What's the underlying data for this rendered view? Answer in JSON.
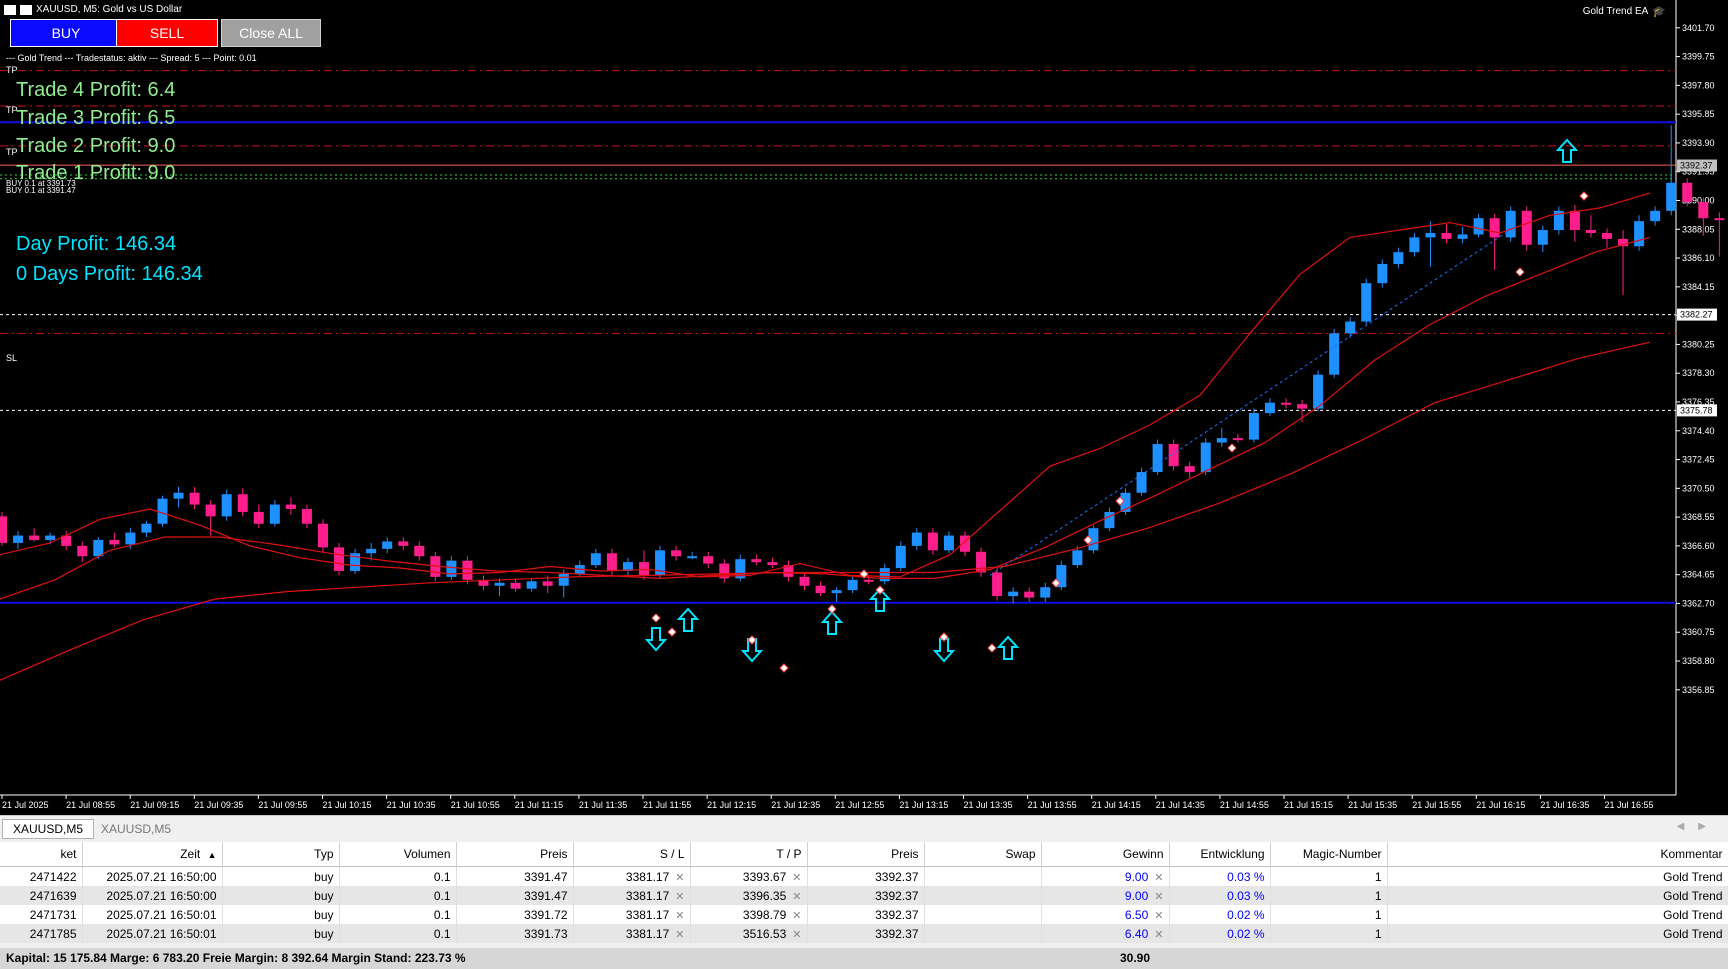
{
  "window": {
    "title": "XAUUSD, M5:  Gold vs US Dollar",
    "ea_name": "Gold Trend EA"
  },
  "buttons": {
    "buy": "BUY",
    "sell": "SELL",
    "close_all": "Close ALL"
  },
  "info_line": "--- Gold Trend --- Tradestatus: aktiv --- Spread: 5 --- Point: 0.01",
  "profits": {
    "trade4": "Trade 4 Profit: 6.4",
    "trade3": "Trade 3 Profit: 6.5",
    "trade2": "Trade 2 Profit: 9.0",
    "trade1": "Trade 1 Profit: 9.0",
    "day": "Day Profit: 146.34",
    "days": "0 Days Profit: 146.34"
  },
  "chart": {
    "line_labels": {
      "tp": "TP",
      "sl": "SL",
      "buy_a": "BUY 0.1 at 3391.73",
      "buy_b": "BUY 0.1 at 3391.47"
    },
    "price_axis": [
      "3401.70",
      "3399.75",
      "3397.80",
      "3395.85",
      "3393.90",
      "3391.95",
      "3390.00",
      "3388.05",
      "3386.10",
      "3384.15",
      "3382.20",
      "3380.25",
      "3378.30",
      "3376.35",
      "3374.40",
      "3372.45",
      "3370.50",
      "3368.55",
      "3366.60",
      "3364.65",
      "3362.70",
      "3360.75",
      "3358.80",
      "3356.85"
    ],
    "price_tags": {
      "current": "3392.37",
      "mid": "3382.27",
      "low": "3375.78"
    },
    "time_axis": [
      "21 Jul 2025",
      "21 Jul 08:55",
      "21 Jul 09:15",
      "21 Jul 09:35",
      "21 Jul 09:55",
      "21 Jul 10:15",
      "21 Jul 10:35",
      "21 Jul 10:55",
      "21 Jul 11:15",
      "21 Jul 11:35",
      "21 Jul 11:55",
      "21 Jul 12:15",
      "21 Jul 12:35",
      "21 Jul 12:55",
      "21 Jul 13:15",
      "21 Jul 13:35",
      "21 Jul 13:55",
      "21 Jul 14:15",
      "21 Jul 14:35",
      "21 Jul 14:55",
      "21 Jul 15:15",
      "21 Jul 15:35",
      "21 Jul 15:55",
      "21 Jul 16:15",
      "21 Jul 16:35",
      "21 Jul 16:55"
    ],
    "colors": {
      "bull": "#1e90ff",
      "bear": "#ff1e8c",
      "ma": "#e01010",
      "tp_line": "#d01010",
      "blue_line": "#1010e0",
      "arrow": "#00e5ff"
    }
  },
  "chart_data": {
    "type": "candlestick",
    "symbol": "XAUUSD",
    "timeframe": "M5",
    "ylim": [
      3356.0,
      3402.5
    ],
    "ohlc": [
      [
        3368.6,
        3368.9,
        3366.6,
        3366.8
      ],
      [
        3366.8,
        3367.6,
        3366.4,
        3367.3
      ],
      [
        3367.3,
        3367.8,
        3366.9,
        3367.0
      ],
      [
        3367.0,
        3367.5,
        3366.7,
        3367.3
      ],
      [
        3367.3,
        3367.6,
        3366.3,
        3366.6
      ],
      [
        3366.6,
        3366.9,
        3365.5,
        3365.9
      ],
      [
        3365.9,
        3367.2,
        3365.7,
        3367.0
      ],
      [
        3367.0,
        3367.5,
        3366.5,
        3366.7
      ],
      [
        3366.7,
        3367.8,
        3366.4,
        3367.5
      ],
      [
        3367.5,
        3368.3,
        3367.2,
        3368.1
      ],
      [
        3368.1,
        3370.0,
        3367.9,
        3369.8
      ],
      [
        3369.8,
        3370.6,
        3369.2,
        3370.2
      ],
      [
        3370.2,
        3370.6,
        3369.1,
        3369.4
      ],
      [
        3369.4,
        3369.7,
        3367.3,
        3368.6
      ],
      [
        3368.6,
        3370.4,
        3368.3,
        3370.1
      ],
      [
        3370.1,
        3370.5,
        3368.6,
        3368.9
      ],
      [
        3368.9,
        3369.4,
        3367.8,
        3368.1
      ],
      [
        3368.1,
        3369.7,
        3367.9,
        3369.4
      ],
      [
        3369.4,
        3369.9,
        3368.7,
        3369.1
      ],
      [
        3369.1,
        3369.4,
        3367.8,
        3368.1
      ],
      [
        3368.1,
        3368.4,
        3366.2,
        3366.5
      ],
      [
        3366.5,
        3366.8,
        3364.6,
        3364.9
      ],
      [
        3364.9,
        3366.4,
        3364.7,
        3366.1
      ],
      [
        3366.1,
        3366.8,
        3365.6,
        3366.4
      ],
      [
        3366.4,
        3367.2,
        3366.1,
        3366.9
      ],
      [
        3366.9,
        3367.2,
        3366.3,
        3366.6
      ],
      [
        3366.6,
        3366.9,
        3365.6,
        3365.9
      ],
      [
        3365.9,
        3366.2,
        3364.2,
        3364.5
      ],
      [
        3364.5,
        3365.9,
        3364.3,
        3365.6
      ],
      [
        3365.6,
        3365.9,
        3364.0,
        3364.3
      ],
      [
        3364.3,
        3364.6,
        3363.6,
        3363.9
      ],
      [
        3363.9,
        3364.4,
        3363.2,
        3364.1
      ],
      [
        3364.1,
        3364.4,
        3363.5,
        3363.7
      ],
      [
        3363.7,
        3364.4,
        3363.5,
        3364.2
      ],
      [
        3364.2,
        3364.6,
        3363.4,
        3363.9
      ],
      [
        3363.9,
        3365.0,
        3363.1,
        3364.7
      ],
      [
        3364.7,
        3365.6,
        3364.5,
        3365.3
      ],
      [
        3365.3,
        3366.4,
        3365.1,
        3366.1
      ],
      [
        3366.1,
        3366.4,
        3364.6,
        3364.9
      ],
      [
        3364.9,
        3365.8,
        3364.6,
        3365.5
      ],
      [
        3365.5,
        3366.3,
        3364.3,
        3364.6
      ],
      [
        3364.6,
        3366.6,
        3364.4,
        3366.3
      ],
      [
        3366.3,
        3366.6,
        3365.6,
        3365.9
      ],
      [
        3365.9,
        3366.2,
        3365.7,
        3365.9
      ],
      [
        3365.9,
        3366.2,
        3365.1,
        3365.4
      ],
      [
        3365.4,
        3365.7,
        3364.1,
        3364.4
      ],
      [
        3364.4,
        3366.0,
        3364.2,
        3365.7
      ],
      [
        3365.7,
        3366.0,
        3365.3,
        3365.5
      ],
      [
        3365.5,
        3365.8,
        3365.1,
        3365.3
      ],
      [
        3365.3,
        3365.6,
        3364.2,
        3364.5
      ],
      [
        3364.5,
        3364.8,
        3363.6,
        3363.9
      ],
      [
        3363.9,
        3364.2,
        3363.2,
        3363.4
      ],
      [
        3363.4,
        3363.8,
        3362.8,
        3363.6
      ],
      [
        3363.6,
        3364.5,
        3363.4,
        3364.3
      ],
      [
        3364.3,
        3364.6,
        3364.0,
        3364.2
      ],
      [
        3364.2,
        3365.4,
        3364.0,
        3365.1
      ],
      [
        3365.1,
        3366.9,
        3364.9,
        3366.6
      ],
      [
        3366.6,
        3367.8,
        3366.3,
        3367.5
      ],
      [
        3367.5,
        3367.8,
        3366.0,
        3366.3
      ],
      [
        3366.3,
        3367.6,
        3366.1,
        3367.3
      ],
      [
        3367.3,
        3367.6,
        3365.9,
        3366.2
      ],
      [
        3366.2,
        3366.5,
        3364.5,
        3364.8
      ],
      [
        3364.8,
        3365.1,
        3362.9,
        3363.2
      ],
      [
        3363.2,
        3363.8,
        3362.7,
        3363.5
      ],
      [
        3363.5,
        3363.8,
        3362.8,
        3363.1
      ],
      [
        3363.1,
        3364.1,
        3362.8,
        3363.8
      ],
      [
        3363.8,
        3365.6,
        3363.6,
        3365.3
      ],
      [
        3365.3,
        3366.6,
        3365.1,
        3366.3
      ],
      [
        3366.3,
        3368.0,
        3366.1,
        3367.8
      ],
      [
        3367.8,
        3369.2,
        3367.6,
        3368.9
      ],
      [
        3368.9,
        3370.5,
        3368.7,
        3370.2
      ],
      [
        3370.2,
        3371.9,
        3370.0,
        3371.6
      ],
      [
        3371.6,
        3373.8,
        3371.4,
        3373.5
      ],
      [
        3373.5,
        3373.8,
        3371.7,
        3372.0
      ],
      [
        3372.0,
        3372.3,
        3371.2,
        3371.6
      ],
      [
        3371.6,
        3373.9,
        3371.4,
        3373.6
      ],
      [
        3373.6,
        3374.6,
        3373.3,
        3373.9
      ],
      [
        3373.9,
        3374.2,
        3373.6,
        3373.8
      ],
      [
        3373.8,
        3375.9,
        3373.6,
        3375.6
      ],
      [
        3375.6,
        3376.6,
        3375.4,
        3376.3
      ],
      [
        3376.3,
        3376.6,
        3375.9,
        3376.2
      ],
      [
        3376.2,
        3376.5,
        3375.0,
        3375.9
      ],
      [
        3375.9,
        3378.5,
        3375.7,
        3378.2
      ],
      [
        3378.2,
        3381.3,
        3378.0,
        3381.0
      ],
      [
        3381.0,
        3382.1,
        3380.7,
        3381.8
      ],
      [
        3381.8,
        3384.7,
        3381.6,
        3384.4
      ],
      [
        3384.4,
        3386.0,
        3384.1,
        3385.7
      ],
      [
        3385.7,
        3386.8,
        3385.4,
        3386.5
      ],
      [
        3386.5,
        3387.8,
        3386.2,
        3387.5
      ],
      [
        3387.5,
        3388.6,
        3385.5,
        3387.8
      ],
      [
        3387.8,
        3388.4,
        3387.1,
        3387.4
      ],
      [
        3387.4,
        3388.2,
        3387.1,
        3387.7
      ],
      [
        3387.7,
        3389.1,
        3387.5,
        3388.8
      ],
      [
        3388.8,
        3389.1,
        3385.3,
        3387.5
      ],
      [
        3387.5,
        3389.6,
        3387.2,
        3389.3
      ],
      [
        3389.3,
        3389.6,
        3386.6,
        3387.0
      ],
      [
        3387.0,
        3388.3,
        3386.5,
        3388.0
      ],
      [
        3388.0,
        3389.6,
        3387.7,
        3389.3
      ],
      [
        3389.3,
        3389.7,
        3387.2,
        3388.0
      ],
      [
        3388.0,
        3389.0,
        3387.5,
        3387.8
      ],
      [
        3387.8,
        3388.1,
        3386.8,
        3387.4
      ],
      [
        3387.4,
        3388.0,
        3383.6,
        3386.9
      ],
      [
        3386.9,
        3389.0,
        3386.6,
        3388.6
      ],
      [
        3388.6,
        3389.6,
        3388.3,
        3389.3
      ],
      [
        3389.3,
        3395.1,
        3389.0,
        3391.2
      ],
      [
        3391.2,
        3391.5,
        3389.6,
        3389.9
      ],
      [
        3389.9,
        3390.2,
        3387.6,
        3388.8
      ],
      [
        3388.8,
        3389.2,
        3386.2,
        3388.7
      ],
      [
        3388.7,
        3391.6,
        3388.4,
        3391.3
      ],
      [
        3391.3,
        3392.9,
        3391.0,
        3392.37
      ]
    ],
    "moving_averages": [
      {
        "period": "fast",
        "values": [
          3366.0,
          3366.8,
          3368.4,
          3369.1,
          3368.0,
          3366.6,
          3365.8,
          3365.3,
          3365.1,
          3364.7,
          3364.8,
          3365.2,
          3364.9,
          3365.0,
          3364.5,
          3364.6,
          3365.4,
          3364.6,
          3364.5,
          3366.0,
          3369.0,
          3372.0,
          3373.2,
          3374.8,
          3376.8,
          3381.0,
          3385.0,
          3387.5,
          3388.0,
          3388.5,
          3387.8,
          3389.0,
          3389.5,
          3390.5
        ]
      },
      {
        "period": "mid",
        "values": [
          3363.0,
          3364.3,
          3366.3,
          3367.2,
          3367.2,
          3366.7,
          3366.1,
          3365.6,
          3365.2,
          3364.9,
          3364.8,
          3364.6,
          3364.4,
          3364.6,
          3364.8,
          3364.7,
          3364.4,
          3364.4,
          3365.0,
          3366.5,
          3368.3,
          3370.0,
          3371.8,
          3373.6,
          3376.1,
          3379.2,
          3381.6,
          3383.5,
          3385.0,
          3386.5,
          3387.5
        ]
      },
      {
        "period": "slow",
        "values": [
          3357.5,
          3359.6,
          3361.6,
          3363.0,
          3363.5,
          3363.8,
          3364.1,
          3364.3,
          3364.5,
          3364.6,
          3364.7,
          3364.8,
          3364.8,
          3364.8,
          3365.2,
          3366.4,
          3367.8,
          3369.5,
          3371.5,
          3373.8,
          3376.3,
          3377.8,
          3379.3,
          3380.4
        ]
      }
    ],
    "levels": {
      "tp_4": 3398.8,
      "tp_3": 3396.4,
      "blue_upper": 3395.3,
      "tp_2": 3393.7,
      "tp_1": 3392.4,
      "sl_white": 3382.27,
      "sl_red": 3381.0,
      "white_low": 3375.78,
      "blue_lower": 3362.75,
      "entry_high": 3391.73,
      "entry_low": 3391.47
    }
  },
  "tabs": [
    "XAUUSD,M5",
    "XAUUSD,M5"
  ],
  "table": {
    "headers": {
      "ticket": "ket",
      "time": "Zeit",
      "sort_indicator": "▲",
      "type": "Typ",
      "volume": "Volumen",
      "price": "Preis",
      "sl": "S / L",
      "tp": "T / P",
      "cur_price": "Preis",
      "swap": "Swap",
      "profit": "Gewinn",
      "change": "Entwicklung",
      "magic": "Magic-Number",
      "comment": "Kommentar"
    },
    "rows": [
      {
        "ticket": "2471422",
        "time": "2025.07.21 16:50:00",
        "type": "buy",
        "volume": "0.1",
        "price": "3391.47",
        "sl": "3381.17",
        "tp": "3393.67",
        "cur_price": "3392.37",
        "swap": "",
        "profit": "9.00",
        "change": "0.03 %",
        "magic": "1",
        "comment": "Gold Trend"
      },
      {
        "ticket": "2471639",
        "time": "2025.07.21 16:50:00",
        "type": "buy",
        "volume": "0.1",
        "price": "3391.47",
        "sl": "3381.17",
        "tp": "3396.35",
        "cur_price": "3392.37",
        "swap": "",
        "profit": "9.00",
        "change": "0.03 %",
        "magic": "1",
        "comment": "Gold Trend"
      },
      {
        "ticket": "2471731",
        "time": "2025.07.21 16:50:01",
        "type": "buy",
        "volume": "0.1",
        "price": "3391.72",
        "sl": "3381.17",
        "tp": "3398.79",
        "cur_price": "3392.37",
        "swap": "",
        "profit": "6.50",
        "change": "0.02 %",
        "magic": "1",
        "comment": "Gold Trend"
      },
      {
        "ticket": "2471785",
        "time": "2025.07.21 16:50:01",
        "type": "buy",
        "volume": "0.1",
        "price": "3391.73",
        "sl": "3381.17",
        "tp": "3516.53",
        "cur_price": "3392.37",
        "swap": "",
        "profit": "6.40",
        "change": "0.02 %",
        "magic": "1",
        "comment": "Gold Trend"
      }
    ],
    "remove_glyph": "✕"
  },
  "status": {
    "summary": "Kapital: 15 175.84  Marge: 6 783.20  Freie Margin: 8 392.64  Margin Stand: 223.73 %",
    "total_profit": "30.90"
  }
}
